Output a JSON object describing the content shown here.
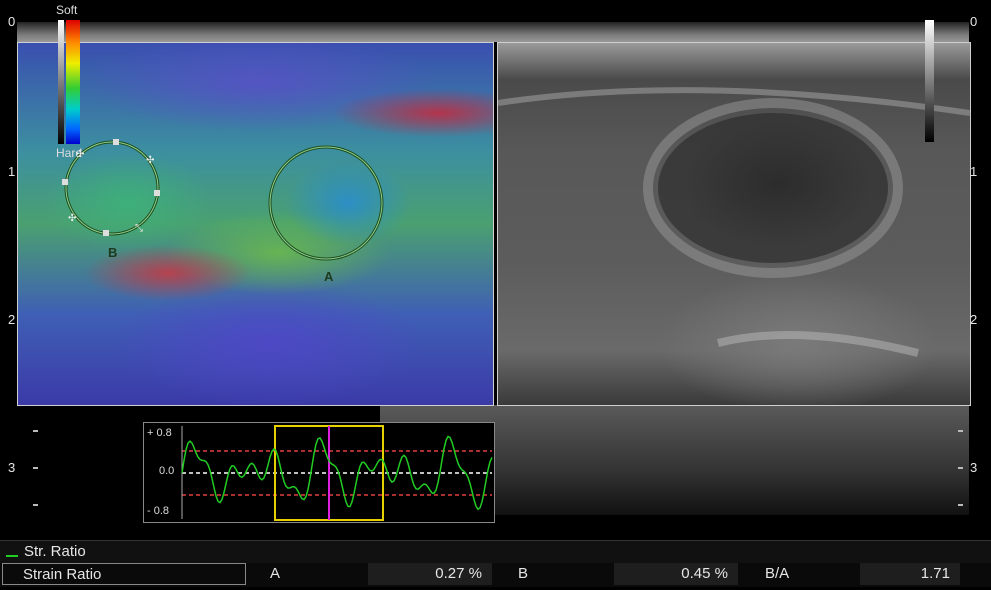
{
  "depth_scale": {
    "left_labels": [
      "0",
      "1",
      "2",
      "3"
    ],
    "right_labels": [
      "0",
      "1",
      "2",
      "3"
    ]
  },
  "elastography": {
    "scale_top_label": "Soft",
    "scale_bottom_label": "Hard",
    "roi_a_label": "A",
    "roi_b_label": "B"
  },
  "strain_graph": {
    "y_labels": [
      "+ 0.8",
      "0.0",
      "- 0.8"
    ],
    "colors": {
      "trace": "#22cc22",
      "window": "#e6d000",
      "cursor": "#e020e0",
      "threshold": "#e04040"
    }
  },
  "results": {
    "legend_label": "Str. Ratio",
    "row_title": "Strain Ratio",
    "a_label": "A",
    "a_value": "0.27 %",
    "b_label": "B",
    "b_value": "0.45 %",
    "ratio_label": "B/A",
    "ratio_value": "1.71"
  }
}
